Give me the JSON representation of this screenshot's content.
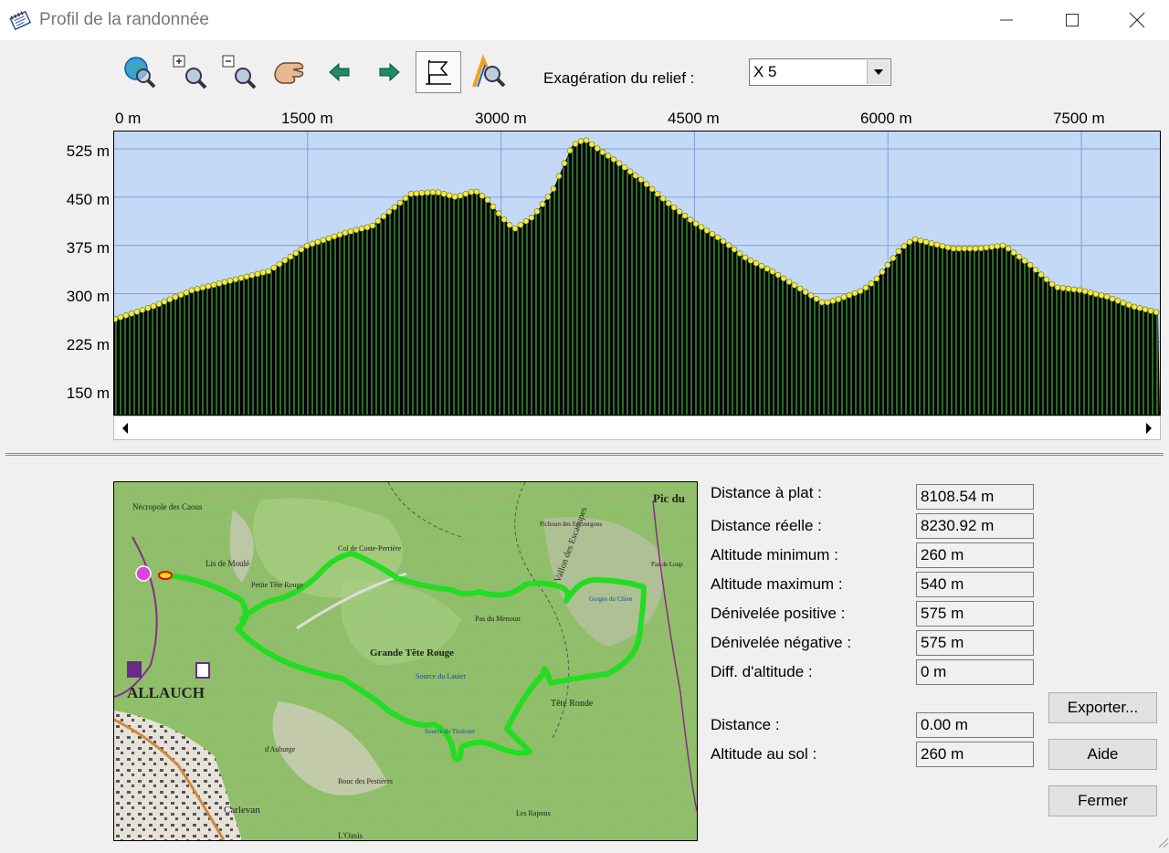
{
  "window": {
    "title": "Profil de la randonnée",
    "app_icon": "notepad-icon",
    "controls": [
      "minimize-icon",
      "maximize-icon",
      "close-icon"
    ]
  },
  "toolbar": {
    "buttons": [
      {
        "icon": "globe-zoom-icon"
      },
      {
        "icon": "zoom-in-icon"
      },
      {
        "icon": "zoom-out-icon"
      },
      {
        "icon": "pan-hand-icon"
      },
      {
        "icon": "arrow-left-icon"
      },
      {
        "icon": "arrow-right-icon"
      },
      {
        "icon": "flag-profile-icon",
        "pressed": true
      },
      {
        "icon": "hiker-zoom-icon"
      }
    ],
    "exaggeration_label": "Exagération du relief :",
    "exaggeration_value": "X 5"
  },
  "profile": {
    "x_ticks": [
      "0 m",
      "1500 m",
      "3000 m",
      "4500 m",
      "6000 m",
      "7500 m"
    ],
    "y_ticks": [
      "525 m",
      "450 m",
      "375 m",
      "300 m",
      "225 m",
      "150 m"
    ],
    "colors": {
      "sky": "#c4d9f6",
      "terrain": "#000000",
      "bars": "#3e9b3e",
      "points": "#f5ec3c",
      "grid": "#7f9fe0"
    }
  },
  "chart_data": {
    "type": "area",
    "xlabel": "",
    "ylabel": "",
    "xlim": [
      0,
      8108.54
    ],
    "ylim": [
      112,
      552
    ],
    "x": [
      0,
      300,
      600,
      900,
      1200,
      1500,
      1800,
      2000,
      2100,
      2300,
      2500,
      2650,
      2800,
      2900,
      3000,
      3100,
      3250,
      3400,
      3550,
      3650,
      3750,
      3900,
      4100,
      4300,
      4500,
      4700,
      4900,
      5100,
      5300,
      5500,
      5600,
      5800,
      5900,
      6000,
      6100,
      6200,
      6500,
      6700,
      6900,
      7100,
      7300,
      7500,
      7700,
      7900,
      8108
    ],
    "y": [
      260,
      280,
      305,
      320,
      335,
      375,
      395,
      405,
      422,
      455,
      458,
      450,
      460,
      445,
      420,
      400,
      420,
      460,
      530,
      540,
      525,
      505,
      475,
      440,
      410,
      385,
      355,
      335,
      310,
      285,
      290,
      305,
      320,
      345,
      370,
      385,
      370,
      370,
      375,
      345,
      310,
      305,
      295,
      280,
      270
    ],
    "title": ""
  },
  "scrollbar": {
    "left_icon": "scroll-left-icon",
    "right_icon": "scroll-right-icon"
  },
  "map": {
    "labels": [
      "Pic du",
      "Nécropole des Caous",
      "Lis de Moulé",
      "Petite Tête Rouge",
      "Col de Coste-Perrière",
      "Pas du Menoun",
      "Grande Tête Rouge",
      "ALLAUCH",
      "Source du Lauier",
      "Tête Ronde",
      "Source du Tholonet",
      "Bouc des Pestières",
      "Les Rapous",
      "Carlevan",
      "L'Oasis",
      "Vallon des Escaoupes",
      "Gorges du Chien",
      "d'Auburge",
      "Pichoun des Escourgons",
      "Pas de Loup"
    ],
    "route_color": "#22dd22"
  },
  "stats": [
    {
      "label": "Distance à plat :",
      "value": "8108.54 m"
    },
    {
      "label": "Distance réelle :",
      "value": "8230.92 m"
    },
    {
      "label": "Altitude minimum :",
      "value": "260 m"
    },
    {
      "label": "Altitude maximum :",
      "value": "540 m"
    },
    {
      "label": "Dénivelée positive :",
      "value": "575 m"
    },
    {
      "label": "Dénivelée négative :",
      "value": "575 m"
    },
    {
      "label": "Diff. d'altitude :",
      "value": "0 m"
    },
    {
      "label": "Distance :",
      "value": "0.00 m"
    },
    {
      "label": "Altitude au sol :",
      "value": "260 m"
    }
  ],
  "buttons": {
    "export": "Exporter...",
    "help": "Aide",
    "close": "Fermer"
  }
}
